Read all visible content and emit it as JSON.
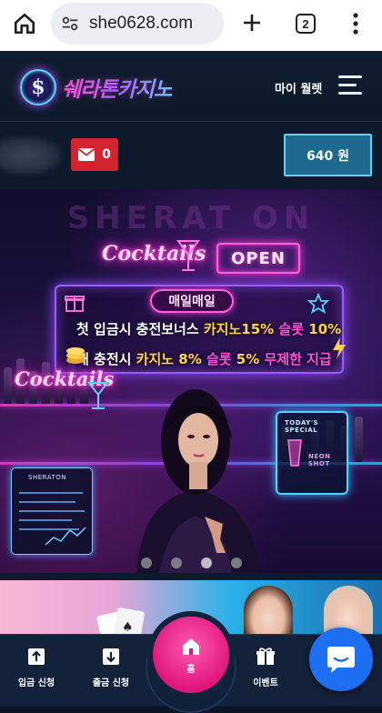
{
  "browser": {
    "url": "she0628.com",
    "tab_count": "2",
    "icons": [
      "home-icon",
      "site-settings-icon",
      "new-tab-plus-icon",
      "tab-switcher-icon",
      "more-vert-icon"
    ]
  },
  "header": {
    "logo_text": "쉐라톤카지노",
    "logo_badge": "$",
    "wallet_label": "마이 월렛",
    "menu_icon": "hamburger-icon"
  },
  "userbar": {
    "mail_count": "0",
    "mail_icon": "envelope-icon",
    "balance": "640 원"
  },
  "banner": {
    "watermark": "SHERAT ON",
    "cocktails_1": "Cocktails",
    "cocktails_2": "Cocktails",
    "open_sign": "OPEN",
    "promo_title": "매일매일",
    "line1_a": "첫 입금시 충전보너스 ",
    "line1_b": "카지노15%",
    "line1_c": " 슬롯 ",
    "line1_d": "10%",
    "line2_a": "재 충전시 ",
    "line2_b": "카지노 8%",
    "line2_c": " 슬롯 ",
    "line2_d": "5%",
    "line2_e": " 무제한 지급",
    "special_label": "TODAY'S SPECIAL",
    "neon_shot": "NEON SHOT",
    "menu_board_title": "SHERATON",
    "slide_count": 4,
    "active_slide": 2
  },
  "bottom_nav": {
    "deposit": "입금 신청",
    "withdraw": "출금 신청",
    "home": "홈",
    "event": "이벤트"
  },
  "colors": {
    "header_bg": "#0d1a2b",
    "mail_red": "#d3232e",
    "balance_bg": "#1d6a8e",
    "home_pink": "#e0157c",
    "chat_blue": "#1c6ef2"
  }
}
